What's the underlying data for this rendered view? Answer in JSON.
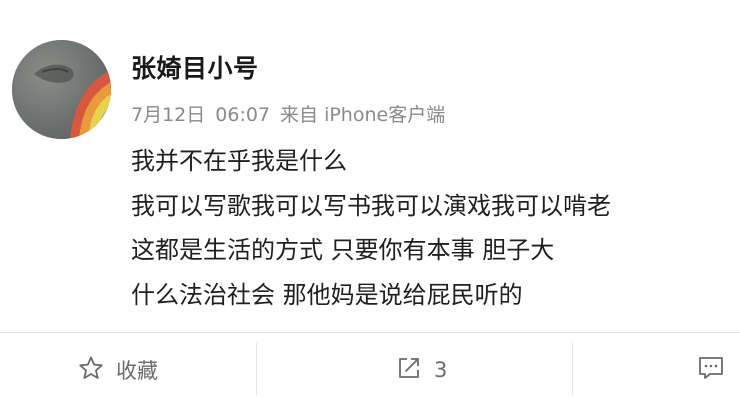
{
  "post": {
    "username": "张婍目小号",
    "date": "7月12日",
    "time": "06:07",
    "source": "来自 iPhone客户端",
    "lines": [
      "我并不在乎我是什么",
      "我可以写歌我可以写书我可以演戏我可以啃老",
      "这都是生活的方式 只要你有本事 胆子大",
      "什么法治社会 那他妈是说给屁民听的"
    ]
  },
  "actions": {
    "favorite": {
      "icon": "star-icon",
      "label": "收藏"
    },
    "repost": {
      "icon": "share-icon",
      "count": "3"
    },
    "comment": {
      "icon": "comment-icon"
    }
  },
  "colors": {
    "text": "#1f1f1f",
    "meta": "#8a8a8a",
    "action": "#6b6b6b",
    "divider": "#e6e6e6"
  }
}
